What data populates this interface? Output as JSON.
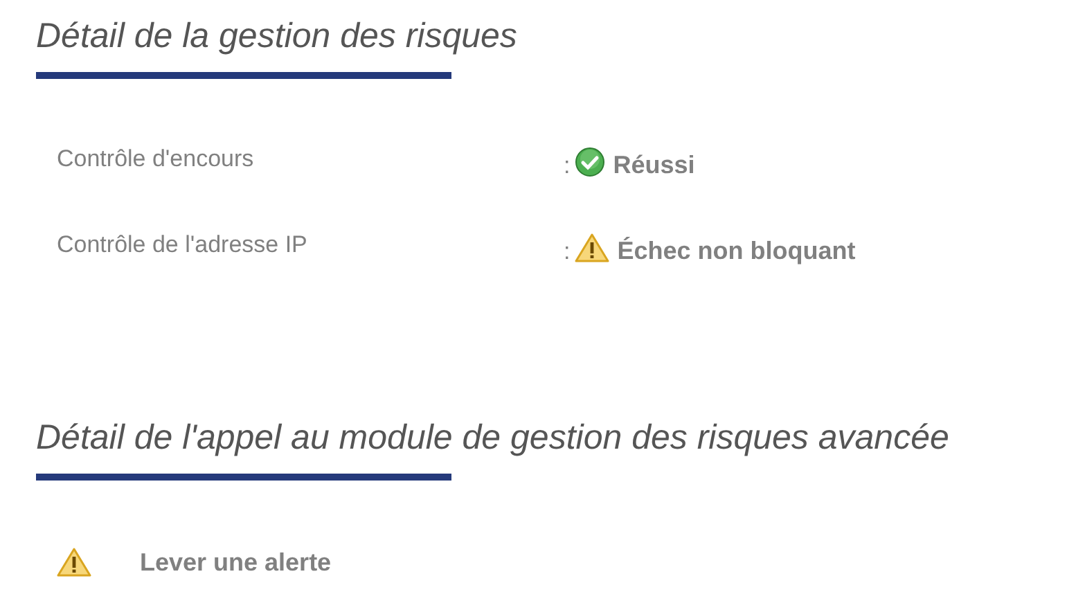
{
  "risk_section": {
    "title": "Détail de la gestion des risques",
    "checks": [
      {
        "label": "Contrôle d'encours",
        "separator": ":",
        "kind": "success",
        "result": "Réussi"
      },
      {
        "label": "Contrôle de l'adresse IP",
        "separator": ":",
        "kind": "warning",
        "result": "Échec non bloquant"
      }
    ]
  },
  "advanced_section": {
    "title": "Détail de l'appel au module de gestion des risques avancée",
    "actions": [
      {
        "kind": "warning",
        "label": "Lever une alerte"
      }
    ]
  }
}
